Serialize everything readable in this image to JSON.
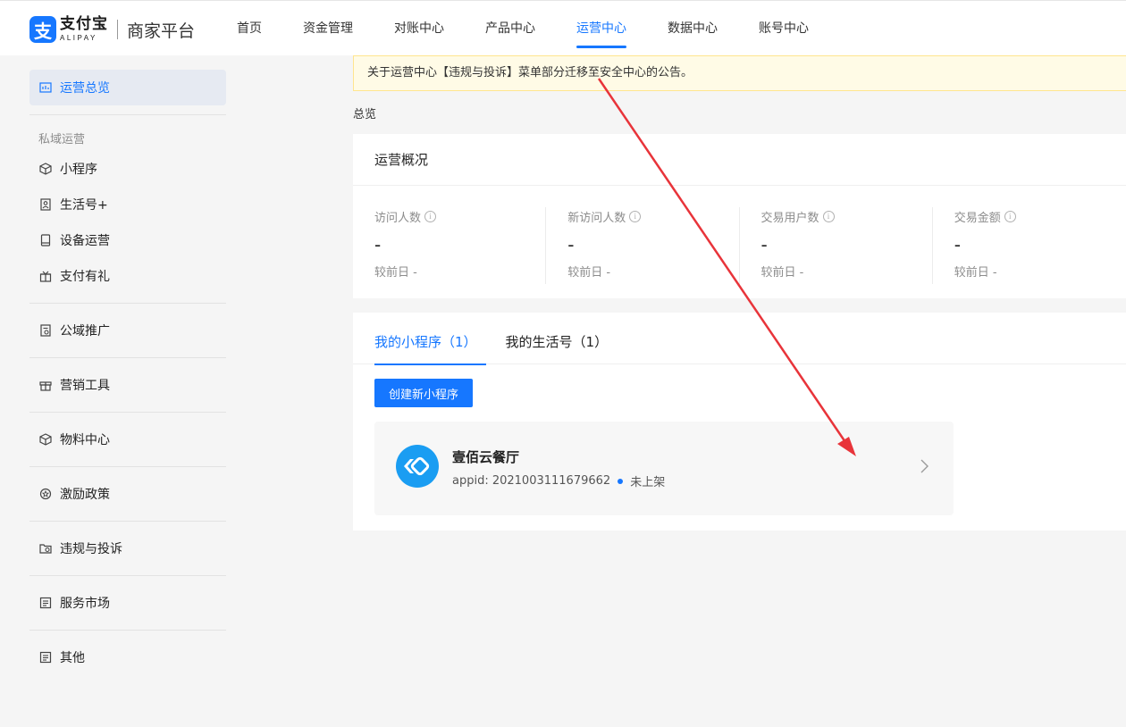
{
  "brand": {
    "mark": "支",
    "name_cn": "支付宝",
    "name_en": "ALIPAY",
    "platform": "商家平台"
  },
  "nav": [
    {
      "label": "首页"
    },
    {
      "label": "资金管理"
    },
    {
      "label": "对账中心"
    },
    {
      "label": "产品中心"
    },
    {
      "label": "运营中心",
      "active": true
    },
    {
      "label": "数据中心"
    },
    {
      "label": "账号中心"
    }
  ],
  "sidebar": {
    "overview": "运营总览",
    "group_private": "私域运营",
    "private_items": [
      "小程序",
      "生活号+",
      "设备运营",
      "支付有礼"
    ],
    "public": "公域推广",
    "marketing": "营销工具",
    "materials": "物料中心",
    "incentive": "激励政策",
    "violations": "违规与投诉",
    "market": "服务市场",
    "other": "其他"
  },
  "notice": "关于运营中心【违规与投诉】菜单部分迁移至安全中心的公告。",
  "breadcrumb": "总览",
  "overview": {
    "title": "运营概况",
    "stats": [
      {
        "label": "访问人数",
        "value": "-",
        "compare": "较前日 -"
      },
      {
        "label": "新访问人数",
        "value": "-",
        "compare": "较前日 -"
      },
      {
        "label": "交易用户数",
        "value": "-",
        "compare": "较前日 -"
      },
      {
        "label": "交易金额",
        "value": "-",
        "compare": "较前日 -"
      }
    ]
  },
  "tabs": [
    {
      "label": "我的小程序（1）",
      "active": true
    },
    {
      "label": "我的生活号（1）"
    }
  ],
  "create_button": "创建新小程序",
  "app": {
    "name": "壹佰云餐厅",
    "appid": "appid: 2021003111679662",
    "status": "未上架",
    "chevron": "chevron-right-icon"
  },
  "colors": {
    "primary": "#1677ff",
    "notice_bg": "#fffbe6",
    "annotation_arrow": "#e8343a"
  }
}
